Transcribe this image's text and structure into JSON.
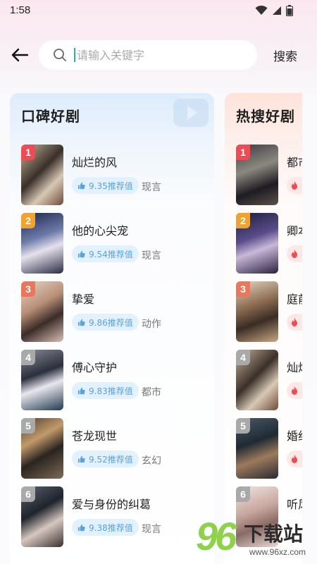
{
  "status_bar": {
    "time": "1:58"
  },
  "search": {
    "placeholder": "请输入关键字",
    "button_label": "搜索"
  },
  "left_panel": {
    "title": "口碑好剧",
    "items": [
      {
        "rank": "1",
        "title": "灿烂的风",
        "score": "9.35推荐值",
        "genre": "现言"
      },
      {
        "rank": "2",
        "title": "他的心尖宠",
        "score": "9.54推荐值",
        "genre": "现言"
      },
      {
        "rank": "3",
        "title": "挚爱",
        "score": "9.86推荐值",
        "genre": "动作"
      },
      {
        "rank": "4",
        "title": "傅心守护",
        "score": "9.83推荐值",
        "genre": "都市"
      },
      {
        "rank": "5",
        "title": "苍龙现世",
        "score": "9.52推荐值",
        "genre": "玄幻"
      },
      {
        "rank": "6",
        "title": "爱与身份的纠葛",
        "score": "9.38推荐值",
        "genre": "现言"
      }
    ]
  },
  "right_panel": {
    "title": "热搜好剧",
    "items": [
      {
        "rank": "1",
        "title": "都市"
      },
      {
        "rank": "2",
        "title": "卿本"
      },
      {
        "rank": "3",
        "title": "庭前"
      },
      {
        "rank": "4",
        "title": "灿烂"
      },
      {
        "rank": "5",
        "title": "婚约"
      },
      {
        "rank": "6",
        "title": "听风"
      }
    ]
  },
  "watermark": {
    "logo": "96",
    "text": "下载站",
    "url": "www.96xz.com"
  },
  "colors": {
    "accent": "#5aa2de",
    "hot": "#ef4b55",
    "rank_gold": "#f1a32d"
  }
}
